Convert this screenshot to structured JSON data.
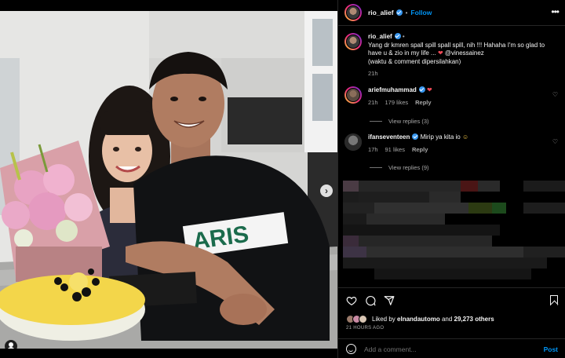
{
  "post": {
    "image_alt": "",
    "carousel_dots": 4,
    "carousel_active": 0
  },
  "header": {
    "username": "rio_alief",
    "bullet": "•",
    "follow_label": "Follow",
    "more_icon": "more-horizontal-icon"
  },
  "caption": {
    "username": "rio_alief",
    "bullet": "•",
    "text": "Yang dr kmren spall spill spall spill, nih !!! Hahaha I'm so glad to have u & zio in my life ...",
    "mention": "@vinessainez",
    "line2": "(waktu & comment dipersilahkan)",
    "time": "21h"
  },
  "comments": [
    {
      "username": "ariefmuhammad",
      "text": "",
      "time": "21h",
      "likes": "179 likes",
      "reply_label": "Reply",
      "view_replies": "View replies (3)"
    },
    {
      "username": "ifanseventeen",
      "text": "Mirip ya kita io",
      "time": "17h",
      "likes": "91 likes",
      "reply_label": "Reply",
      "view_replies": "View replies (9)"
    }
  ],
  "actions": {
    "like_icon": "heart-icon",
    "comment_icon": "comment-icon",
    "share_icon": "share-icon",
    "save_icon": "bookmark-icon"
  },
  "likes": {
    "prefix": "Liked by",
    "user": "elnandautomo",
    "middle": "and",
    "count": "29,273 others"
  },
  "timestamp": "21 HOURS AGO",
  "add_comment": {
    "placeholder": "Add a comment...",
    "post_label": "Post"
  }
}
